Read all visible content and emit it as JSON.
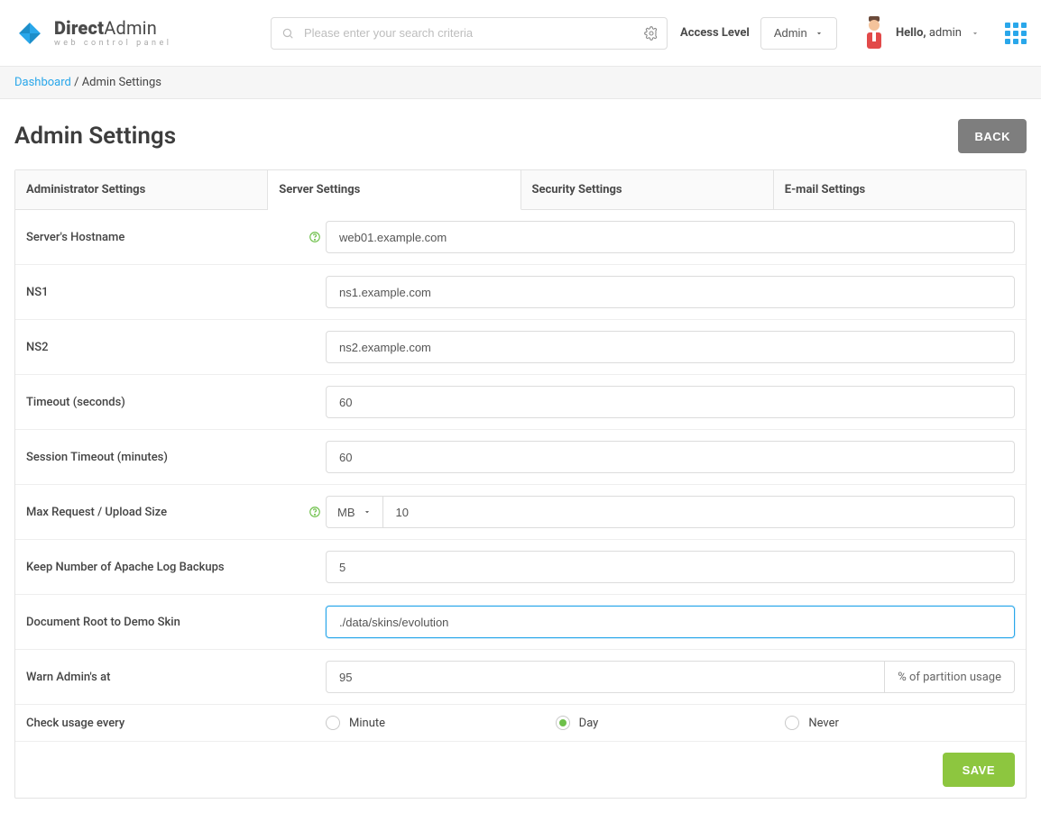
{
  "brand": {
    "name_bold": "Direct",
    "name_light": "Admin",
    "sub": "web control panel"
  },
  "search": {
    "placeholder": "Please enter your search criteria"
  },
  "access": {
    "label": "Access Level",
    "value": "Admin"
  },
  "user": {
    "greeting": "Hello,",
    "name": "admin"
  },
  "crumbs": {
    "home": "Dashboard",
    "sep": " / ",
    "current": "Admin Settings"
  },
  "page": {
    "title": "Admin Settings",
    "back": "BACK",
    "save": "SAVE"
  },
  "tabs": {
    "admin": "Administrator Settings",
    "server": "Server Settings",
    "security": "Security Settings",
    "email": "E-mail Settings"
  },
  "fields": {
    "hostname": {
      "label": "Server's Hostname",
      "value": "web01.example.com"
    },
    "ns1": {
      "label": "NS1",
      "value": "ns1.example.com"
    },
    "ns2": {
      "label": "NS2",
      "value": "ns2.example.com"
    },
    "timeout": {
      "label": "Timeout (seconds)",
      "value": "60"
    },
    "session": {
      "label": "Session Timeout (minutes)",
      "value": "60"
    },
    "maxreq": {
      "label": "Max Request / Upload Size",
      "unit": "MB",
      "value": "10"
    },
    "apachelogs": {
      "label": "Keep Number of Apache Log Backups",
      "value": "5"
    },
    "docroot": {
      "label": "Document Root to Demo Skin",
      "value": "./data/skins/evolution"
    },
    "warn": {
      "label": "Warn Admin's at",
      "value": "95",
      "suffix": "% of partition usage"
    },
    "checkusage": {
      "label": "Check usage every",
      "opt_minute": "Minute",
      "opt_day": "Day",
      "opt_never": "Never",
      "selected": "day"
    }
  }
}
